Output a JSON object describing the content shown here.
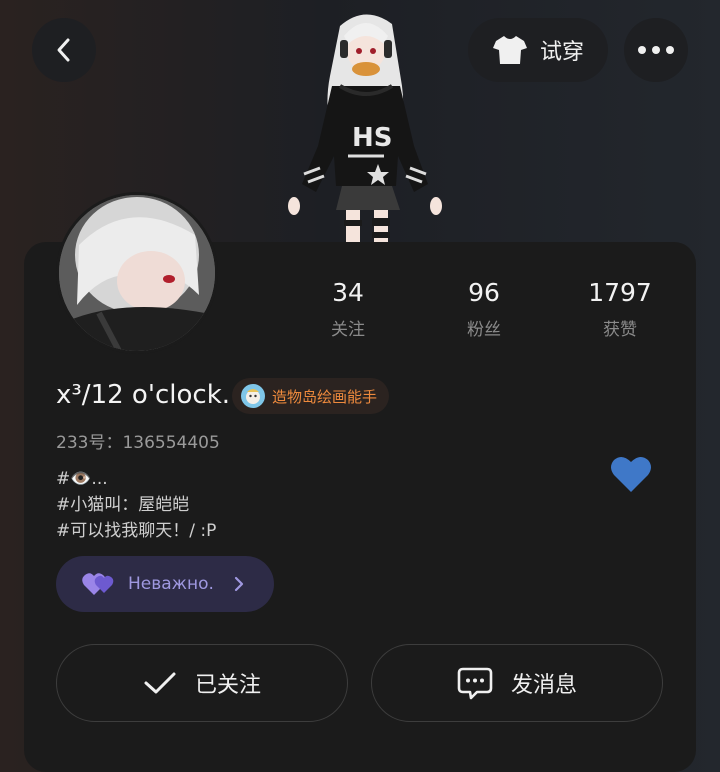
{
  "header": {
    "back_icon": "chevron-left-icon",
    "try_on_label": "试穿",
    "try_on_icon": "tshirt-icon",
    "more_icon": "more-dots-icon"
  },
  "stats": [
    {
      "value": "34",
      "label": "关注"
    },
    {
      "value": "96",
      "label": "粉丝"
    },
    {
      "value": "1797",
      "label": "获赞"
    }
  ],
  "profile": {
    "username": "x³/12 o'clock.",
    "badge_label": "造物岛绘画能手",
    "uid": "233号：136554405",
    "bio_lines": [
      "#👁️...",
      "#小猫叫：屋皑皑",
      "#可以找我聊天！/ :P"
    ]
  },
  "mood": {
    "label": "Неважно.",
    "color": "#9f98e0"
  },
  "actions": {
    "follow_label": "已关注",
    "message_label": "发消息"
  },
  "colors": {
    "heart": "#3f78c8",
    "badge_text": "#ee8a3d",
    "card": "#1b1b1b"
  }
}
